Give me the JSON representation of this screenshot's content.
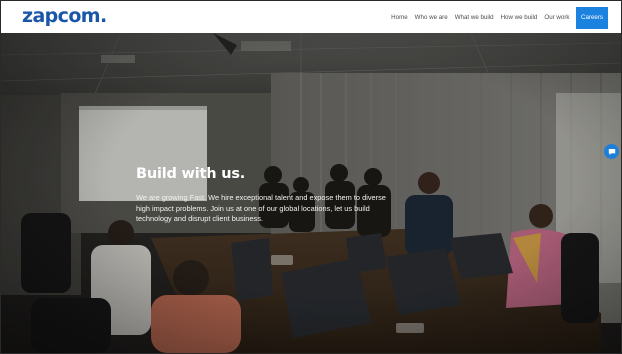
{
  "header": {
    "logo": "zapcom",
    "logo_dot": ".",
    "nav": [
      {
        "label": "Home"
      },
      {
        "label": "Who we are"
      },
      {
        "label": "What we build"
      },
      {
        "label": "How we build"
      },
      {
        "label": "Our work"
      },
      {
        "label": "Careers",
        "active": true
      }
    ]
  },
  "hero": {
    "title": "Build with us.",
    "description": "We are growing Fast. We hire exceptional talent and expose them to diverse high impact problems. Join us at one of our global locations, let us build technology and disrupt client business."
  },
  "chat": {
    "icon": "chat-icon",
    "color": "#1e7fd8"
  },
  "colors": {
    "brand": "#1a56a8",
    "nav_active": "#1c82e0"
  }
}
